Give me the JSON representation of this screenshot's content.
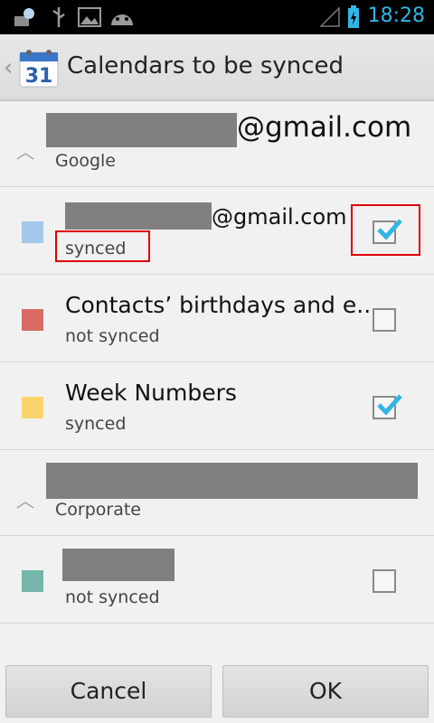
{
  "status_bar": {
    "time": "18:28",
    "icons": [
      "notification-icon",
      "usb-icon",
      "gallery-icon",
      "android-debug-icon",
      "signal-icon",
      "battery-charging-icon"
    ],
    "accent_color": "#33b5e5"
  },
  "action_bar": {
    "app_icon_number": "31",
    "title": "Calendars to be synced"
  },
  "accounts": [
    {
      "email_suffix": "@gmail.com",
      "type": "Google",
      "calendars": [
        {
          "email_suffix": "@gmail.com",
          "status": "synced",
          "checked": true,
          "color": "#a4c8ec"
        },
        {
          "title": "Contacts’ birthdays and e..",
          "status": "not synced",
          "checked": false,
          "color": "#d96a64"
        },
        {
          "title": "Week Numbers",
          "status": "synced",
          "checked": true,
          "color": "#fcd46e"
        }
      ]
    },
    {
      "type": "Corporate",
      "calendars": [
        {
          "status": "not synced",
          "checked": false,
          "color": "#75b5aa"
        }
      ]
    }
  ],
  "buttons": {
    "cancel": "Cancel",
    "ok": "OK"
  }
}
